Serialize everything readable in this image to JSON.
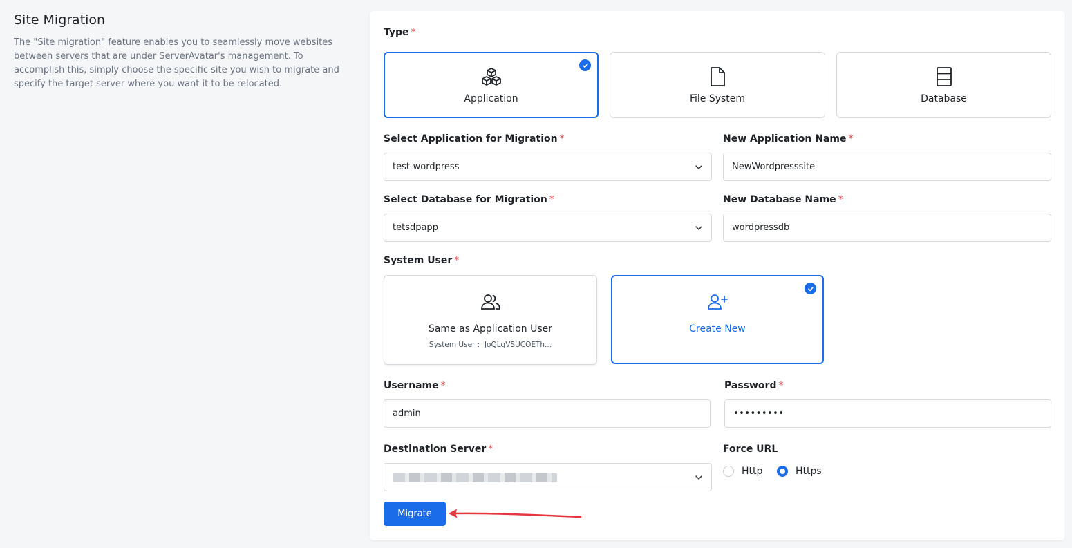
{
  "intro": {
    "title": "Site Migration",
    "description": "The \"Site migration\" feature enables you to seamlessly move websites between servers that are under ServerAvatar's management. To accomplish this, simply choose the specific site you wish to migrate and specify the target server where you want it to be relocated."
  },
  "type": {
    "label": "Type",
    "options": [
      {
        "label": "Application",
        "icon": "cubes-icon",
        "selected": true
      },
      {
        "label": "File System",
        "icon": "file-icon",
        "selected": false
      },
      {
        "label": "Database",
        "icon": "database-icon",
        "selected": false
      }
    ]
  },
  "select_app": {
    "label": "Select Application for Migration",
    "value": "test-wordpress"
  },
  "new_app_name": {
    "label": "New Application Name",
    "value": "NewWordpresssite"
  },
  "select_db": {
    "label": "Select Database for Migration",
    "value": "tetsdpapp"
  },
  "new_db_name": {
    "label": "New Database Name",
    "value": "wordpressdb"
  },
  "system_user": {
    "label": "System User",
    "same": {
      "label": "Same as Application User",
      "sub_label": "System User :",
      "sub_value": "JoQLqVSUCOETh...",
      "selected": false
    },
    "create": {
      "label": "Create New",
      "selected": true
    }
  },
  "username": {
    "label": "Username",
    "value": "admin"
  },
  "password": {
    "label": "Password",
    "value": "•••••••••"
  },
  "destination": {
    "label": "Destination Server",
    "value_redacted": true
  },
  "force_url": {
    "label": "Force URL",
    "options": [
      {
        "label": "Http",
        "selected": false
      },
      {
        "label": "Https",
        "selected": true
      }
    ]
  },
  "migrate_label": "Migrate",
  "colors": {
    "accent": "#1a6ce8",
    "required": "#e5484d",
    "arrow": "#e5363f"
  }
}
